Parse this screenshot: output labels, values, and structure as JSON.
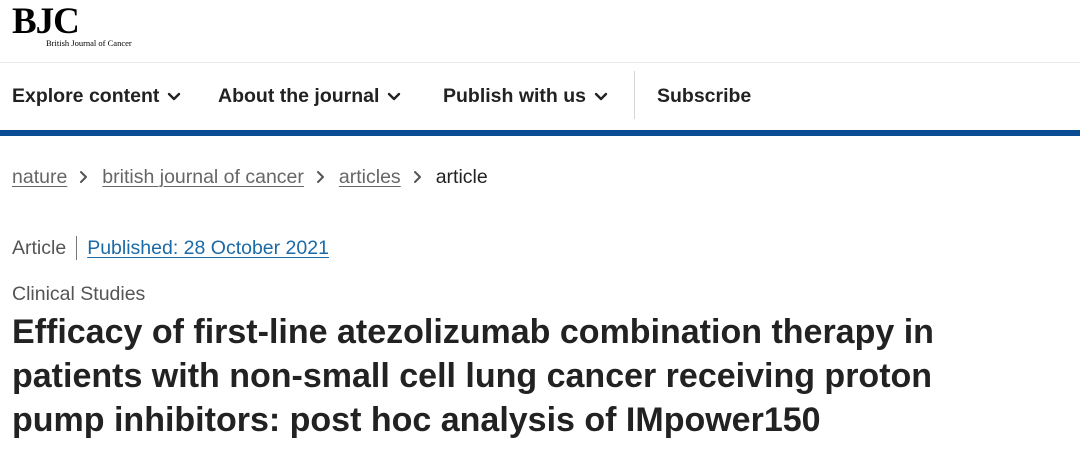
{
  "header": {
    "logo_mark": "BJC",
    "logo_subtitle": "British Journal of Cancer"
  },
  "nav": {
    "items": [
      {
        "label": "Explore content",
        "icon": "chevron-down-icon"
      },
      {
        "label": "About the journal",
        "icon": "chevron-down-icon"
      },
      {
        "label": "Publish with us",
        "icon": "chevron-down-icon"
      },
      {
        "label": "Subscribe"
      }
    ],
    "accent_color": "#0a4d94"
  },
  "breadcrumb": {
    "items": [
      {
        "label": "nature"
      },
      {
        "label": "british journal of cancer"
      },
      {
        "label": "articles"
      }
    ],
    "current": "article",
    "separator_icon": "chevron-right-icon"
  },
  "article": {
    "type": "Article",
    "published": "Published: 28 October 2021",
    "section": "Clinical Studies",
    "title": "Efficacy of first-line atezolizumab combination therapy in patients with non-small cell lung cancer receiving proton pump inhibitors: post hoc analysis of IMpower150",
    "link_color": "#1b6aa8"
  }
}
